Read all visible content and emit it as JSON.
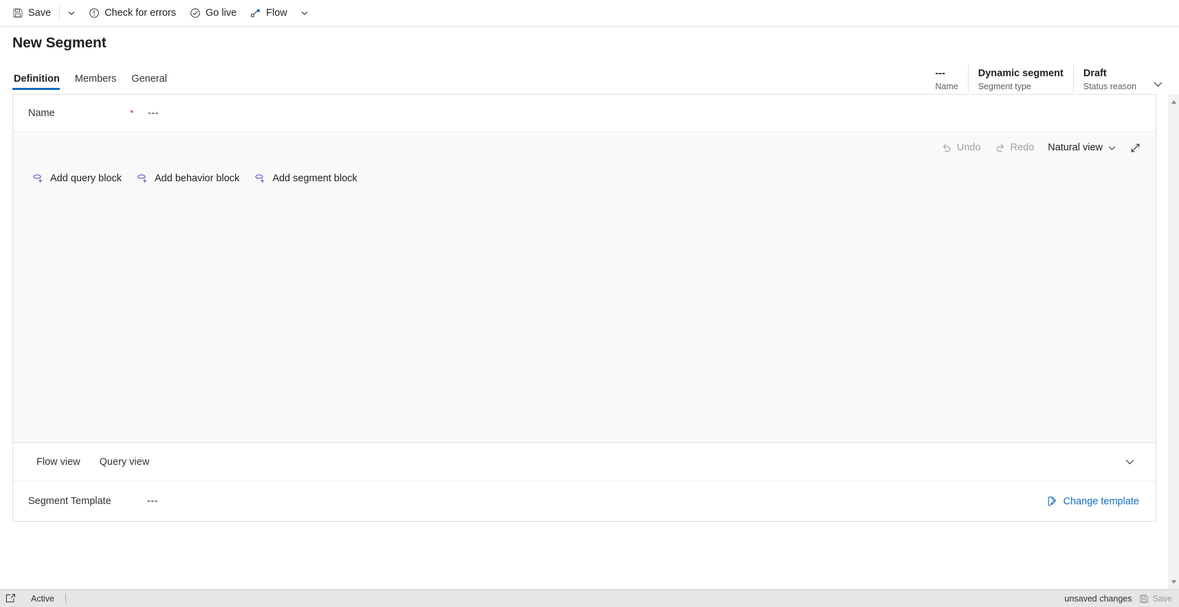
{
  "commandbar": {
    "save_label": "Save",
    "save_icon": "save-floppy-icon",
    "save_dropdown_icon": "chevron-down-icon",
    "check_errors_label": "Check for errors",
    "check_errors_icon": "exclamation-circle-icon",
    "go_live_label": "Go live",
    "go_live_icon": "check-circle-icon",
    "flow_label": "Flow",
    "flow_icon": "flow-node-icon",
    "flow_dropdown_icon": "chevron-down-icon"
  },
  "header": {
    "title": "New Segment",
    "fields": [
      {
        "value": "---",
        "label": "Name"
      },
      {
        "value": "Dynamic segment",
        "label": "Segment type"
      },
      {
        "value": "Draft",
        "label": "Status reason"
      }
    ],
    "expand_icon": "chevron-down-icon"
  },
  "tabs": [
    {
      "label": "Definition",
      "active": true
    },
    {
      "label": "Members",
      "active": false
    },
    {
      "label": "General",
      "active": false
    }
  ],
  "form": {
    "name_label": "Name",
    "required_marker": "*",
    "name_value": "---"
  },
  "canvas_toolbar": {
    "undo_label": "Undo",
    "undo_icon": "undo-arrow-icon",
    "redo_label": "Redo",
    "redo_icon": "redo-arrow-icon",
    "view_mode_label": "Natural view",
    "view_mode_icon": "chevron-down-icon",
    "expand_icon": "expand-diagonal-icon"
  },
  "block_actions": [
    {
      "label": "Add query block",
      "icon": "add-query-block-icon"
    },
    {
      "label": "Add behavior block",
      "icon": "add-behavior-block-icon"
    },
    {
      "label": "Add segment block",
      "icon": "add-segment-block-icon"
    }
  ],
  "footer_views": {
    "tabs": [
      {
        "label": "Flow view"
      },
      {
        "label": "Query view"
      }
    ],
    "collapse_icon": "chevron-down-icon"
  },
  "template": {
    "label": "Segment Template",
    "value": "---",
    "change_label": "Change template",
    "change_icon": "edit-document-icon"
  },
  "statusbar": {
    "expand_icon": "popout-window-icon",
    "state_label": "Active",
    "unsaved_label": "unsaved changes",
    "save_label": "Save",
    "save_icon": "save-floppy-icon"
  },
  "colors": {
    "accent": "#0f6cbd",
    "link": "#0f6cbd",
    "required": "#a4262c",
    "block_icon": "#5b5fc7",
    "canvas_bg": "#faf9f8",
    "statusbar_bg": "#e6e6e6"
  },
  "scrollbar": {
    "up_icon": "scroll-up-arrow-icon",
    "down_icon": "scroll-down-arrow-icon"
  }
}
